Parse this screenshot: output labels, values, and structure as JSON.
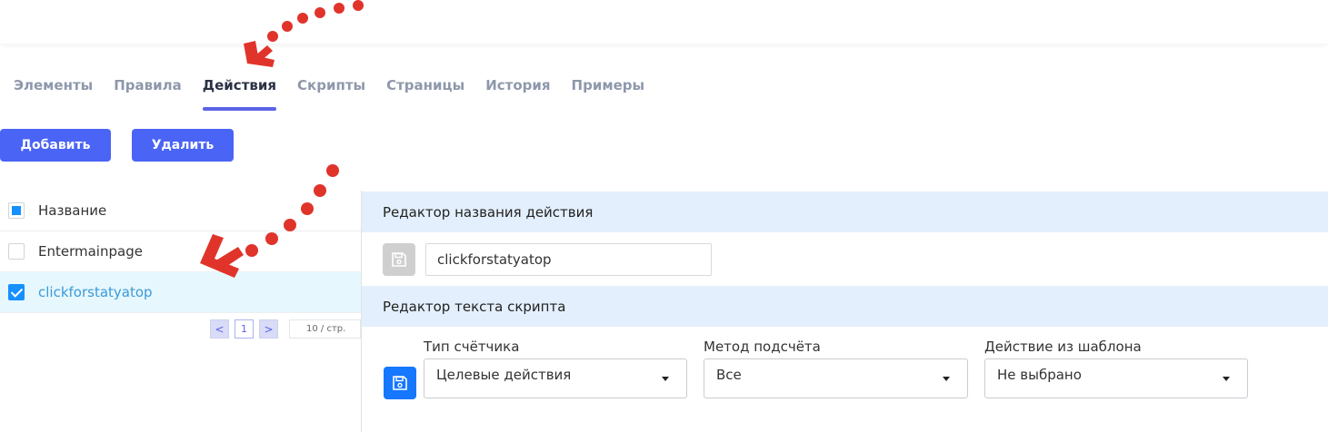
{
  "tabs": [
    {
      "label": "Элементы"
    },
    {
      "label": "Правила"
    },
    {
      "label": "Действия"
    },
    {
      "label": "Скрипты"
    },
    {
      "label": "Страницы"
    },
    {
      "label": "История"
    },
    {
      "label": "Примеры"
    }
  ],
  "toolbar": {
    "add_label": "Добавить",
    "delete_label": "Удалить"
  },
  "list": {
    "header": "Название",
    "items": [
      {
        "name": "Entermainpage",
        "checked": false
      },
      {
        "name": "clickforstatyatop",
        "checked": true
      }
    ],
    "pager": {
      "prev": "<",
      "page": "1",
      "next": ">",
      "page_size": "10 / стр."
    }
  },
  "name_editor": {
    "title": "Редактор названия действия",
    "value": "clickforstatyatop"
  },
  "script_editor": {
    "title": "Редактор текста скрипта",
    "fields": [
      {
        "label": "Тип счётчика",
        "value": "Целевые действия"
      },
      {
        "label": "Метод подсчёта",
        "value": "Все"
      },
      {
        "label": "Действие из шаблона",
        "value": "Не выбрано"
      }
    ]
  },
  "colors": {
    "accent": "#4a64f5",
    "tab_indicator": "#5a63e6",
    "annotation": "#e0342b",
    "section_bg": "#e3effc",
    "selected_row": "#e6f7fd"
  }
}
